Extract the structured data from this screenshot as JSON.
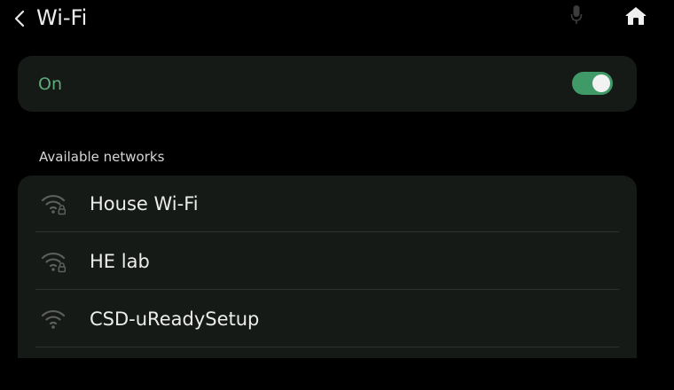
{
  "header": {
    "title": "Wi-Fi",
    "back_icon": "chevron-left-icon",
    "mic_icon": "microphone-icon",
    "home_icon": "home-icon"
  },
  "wifi_toggle": {
    "label": "On",
    "state": "on",
    "label_color": "#5fa97b",
    "accent_color": "#3f9a68"
  },
  "networks": {
    "heading": "Available networks",
    "items": [
      {
        "name": "House Wi-Fi",
        "icon": "wifi-locked-icon",
        "secured": true
      },
      {
        "name": "HE lab",
        "icon": "wifi-locked-icon",
        "secured": true
      },
      {
        "name": "CSD-uReadySetup",
        "icon": "wifi-icon",
        "secured": false
      }
    ]
  }
}
